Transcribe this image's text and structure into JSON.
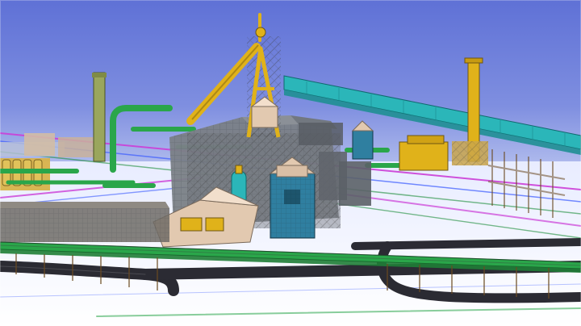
{
  "viewport": {
    "kind": "3d-plant-model-view",
    "colors": {
      "sky_top": "#5f71d6",
      "sky_bottom": "#c7d0f3",
      "ground": "#f7f8ff",
      "conveyor_teal": "#2bb6b9",
      "conveyor_yellow": "#e0b21a",
      "pipe_green": "#2aa64a",
      "structure_grey": "#7a7f86",
      "dust_blue": "#2f7fa0",
      "stack_olive": "#9aa65d",
      "roof_beige": "#e2c9b0",
      "road": "#2b2b33",
      "line_magenta": "#cc3fd8",
      "line_green": "#1f8f3b",
      "line_blue": "#3c5cff"
    }
  }
}
